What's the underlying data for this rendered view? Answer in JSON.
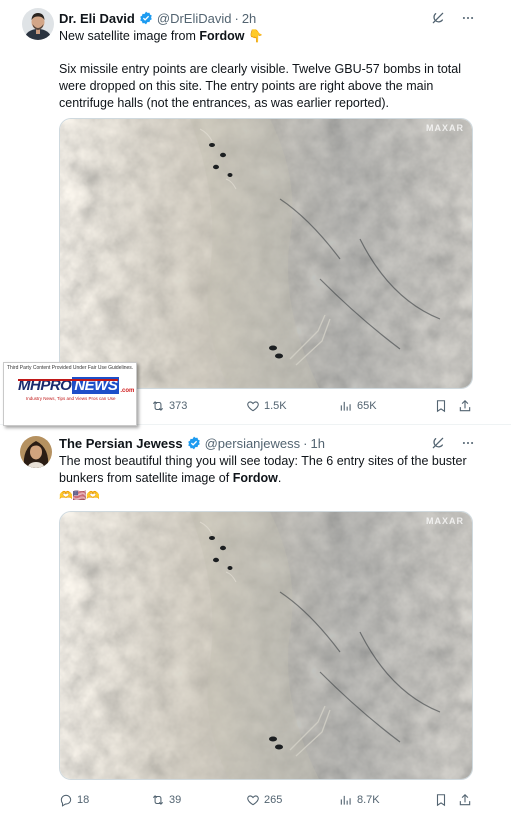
{
  "tweets": [
    {
      "author": "Dr. Eli David",
      "handle": "@DrEliDavid",
      "separator": "·",
      "time": "2h",
      "text_line1_prefix": "New satellite image from ",
      "text_line1_bold": "Fordow",
      "text_line1_emoji": "👇",
      "text_para2": "Six missile entry points are clearly visible. Twelve GBU-57 bombs in total were dropped on this site. The entry points are right above the main centrifuge halls (not the entrances, as was earlier reported).",
      "image_watermark": "MAXAR",
      "actions": {
        "retweets": "373",
        "likes": "1.5K",
        "views": "65K"
      }
    },
    {
      "author": "The Persian Jewess",
      "handle": "@persianjewess",
      "separator": "·",
      "time": "1h",
      "text_prefix": "The most beautiful thing you will see today: The 6 entry sites of the buster bunkers from satellite image of ",
      "text_bold": "Fordow",
      "text_suffix": ".",
      "emoji_line": "🫶🇺🇸🫶",
      "image_watermark": "MAXAR",
      "actions": {
        "replies": "18",
        "retweets": "39",
        "likes": "265",
        "views": "8.7K"
      }
    }
  ],
  "watermark_overlay": {
    "top_text": "Third Party Content Provided Under Fair Use Guidelines.",
    "logo_mh": "MHPRO",
    "logo_news": "NEWS",
    "logo_com": ".com",
    "subtitle": "Industry News, Tips and Views Pros can Use"
  },
  "colors": {
    "verified": "#1d9bf0",
    "text": "#0f1419",
    "muted": "#536471",
    "border": "#cfd9de"
  },
  "icons": [
    "verified-badge-icon",
    "grok-icon",
    "more-icon",
    "reply-icon",
    "retweet-icon",
    "like-icon",
    "views-icon",
    "bookmark-icon",
    "share-icon"
  ]
}
